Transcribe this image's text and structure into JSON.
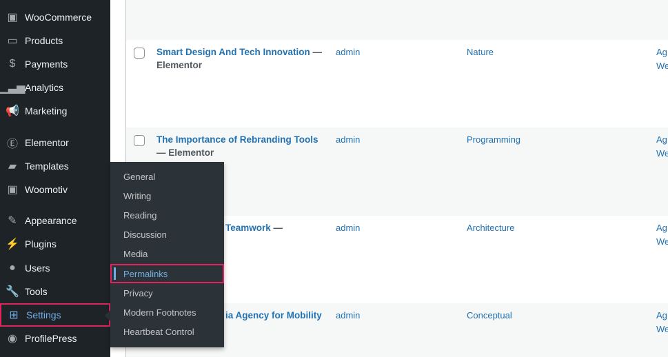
{
  "sidebar": {
    "items": [
      {
        "label": "WooCommerce",
        "icon": "woo-icon"
      },
      {
        "label": "Products",
        "icon": "archive-icon"
      },
      {
        "label": "Payments",
        "icon": "dollar-icon"
      },
      {
        "label": "Analytics",
        "icon": "bar-chart-icon"
      },
      {
        "label": "Marketing",
        "icon": "megaphone-icon"
      },
      {
        "label": "Elementor",
        "icon": "elementor-icon"
      },
      {
        "label": "Templates",
        "icon": "folder-icon"
      },
      {
        "label": "Woomotiv",
        "icon": "woomotiv-icon"
      },
      {
        "label": "Appearance",
        "icon": "brush-icon"
      },
      {
        "label": "Plugins",
        "icon": "plug-icon"
      },
      {
        "label": "Users",
        "icon": "user-icon"
      },
      {
        "label": "Tools",
        "icon": "wrench-icon"
      },
      {
        "label": "Settings",
        "icon": "settings-icon",
        "active": true
      },
      {
        "label": "ProfilePress",
        "icon": "profilepress-icon"
      }
    ]
  },
  "flyout": {
    "items": [
      "General",
      "Writing",
      "Reading",
      "Discussion",
      "Media",
      "Permalinks",
      "Privacy",
      "Modern Footnotes",
      "Heartbeat Control"
    ],
    "current": "Permalinks"
  },
  "posts": [
    {
      "title": "Smart Design And Tech Innovation",
      "suffix": "— Elementor",
      "author": "admin",
      "category": "Nature",
      "tag1": "Ag",
      "tag2": "We"
    },
    {
      "title": "The Importance of Rebranding Tools",
      "suffix": "— Elementor",
      "author": "admin",
      "category": "Programming",
      "tag1": "Ag",
      "tag2": "We"
    },
    {
      "title": "Teamwork",
      "suffix": "—",
      "author": "admin",
      "category": "Architecture",
      "tag1": "Ag",
      "tag2": "We"
    },
    {
      "title": "ia Agency for Mobility",
      "suffix": "",
      "author": "admin",
      "category": "Conceptual",
      "tag1": "Ag",
      "tag2": "We"
    }
  ],
  "colors": {
    "accent": "#72aee6",
    "highlight": "#e0245e",
    "sidebar": "#1d2327",
    "link": "#2271b1"
  }
}
